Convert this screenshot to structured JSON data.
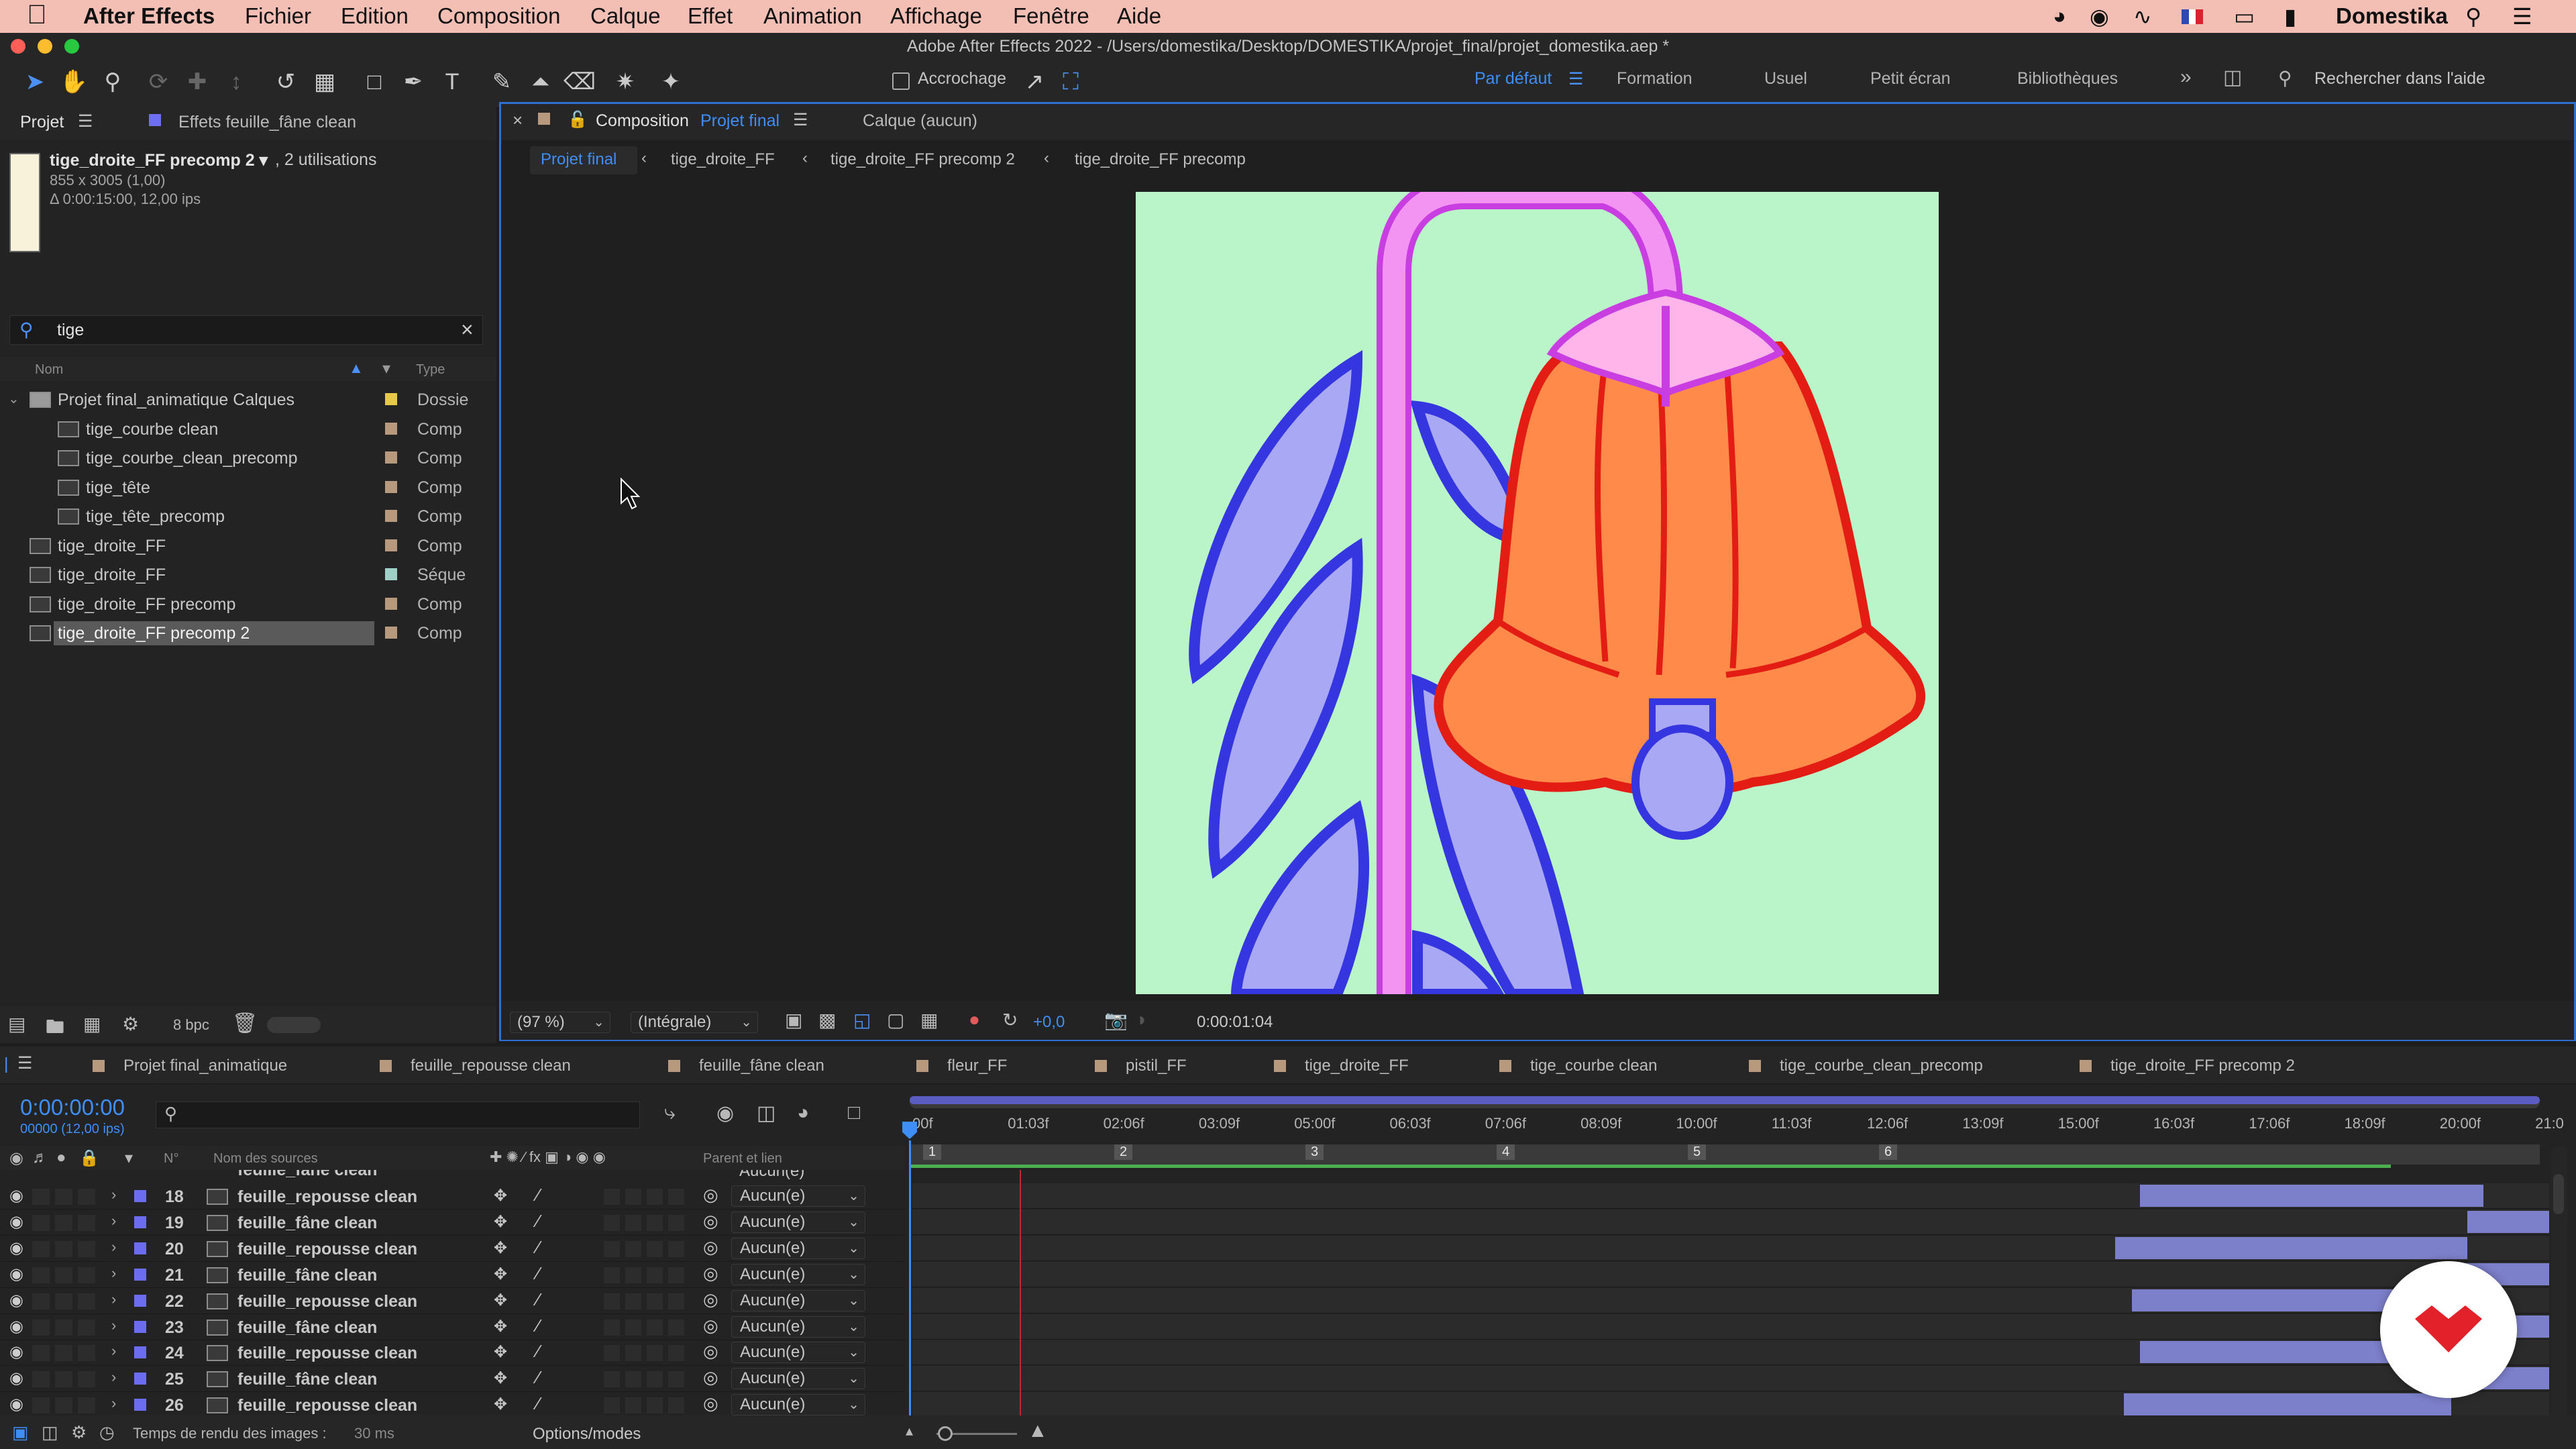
{
  "menubar": {
    "app": "After Effects",
    "items": [
      "Fichier",
      "Edition",
      "Composition",
      "Calque",
      "Effet",
      "Animation",
      "Affichage",
      "Fenêtre",
      "Aide"
    ],
    "right_label": "Domestika"
  },
  "window_title": "Adobe After Effects 2022 - /Users/domestika/Desktop/DOMESTIKA/projet_final/projet_domestika.aep *",
  "toolbar": {
    "snapping": "Accrochage",
    "workspaces": [
      "Par défaut",
      "Formation",
      "Usuel",
      "Petit écran",
      "Bibliothèques"
    ],
    "search_placeholder": "Rechercher dans l'aide"
  },
  "project_panel": {
    "tab_project": "Projet",
    "tab_effects": "Effets  feuille_fâne clean",
    "item_name": "tige_droite_FF precomp 2 ▾",
    "item_uses": ", 2 utilisations",
    "item_dims": "855 x 3005 (1,00)",
    "item_duration": "Δ 0:00:15:00, 12,00 ips",
    "search_value": "tige",
    "col_name": "Nom",
    "col_type": "Type",
    "bpc": "8 bpc",
    "rows": [
      {
        "name": "Projet final_animatique Calques",
        "type": "Dossie",
        "color": "#e6c94a",
        "level": 0
      },
      {
        "name": "tige_courbe clean",
        "type": "Comp",
        "color": "#b79a7e",
        "level": 1
      },
      {
        "name": "tige_courbe_clean_precomp",
        "type": "Comp",
        "color": "#b79a7e",
        "level": 1
      },
      {
        "name": "tige_tête",
        "type": "Comp",
        "color": "#b79a7e",
        "level": 1
      },
      {
        "name": "tige_tête_precomp",
        "type": "Comp",
        "color": "#b79a7e",
        "level": 1
      },
      {
        "name": "tige_droite_FF",
        "type": "Comp",
        "color": "#b79a7e",
        "level": 0
      },
      {
        "name": "tige_droite_FF",
        "type": "Séque",
        "color": "#9fd0c8",
        "level": 0
      },
      {
        "name": "tige_droite_FF precomp",
        "type": "Comp",
        "color": "#b79a7e",
        "level": 0
      },
      {
        "name": "tige_droite_FF precomp 2",
        "type": "Comp",
        "color": "#b79a7e",
        "level": 0,
        "selected": true
      }
    ]
  },
  "comp_panel": {
    "tab_label": "Composition",
    "tab_name": "Projet final",
    "layer_tab": "Calque  (aucun)",
    "breadcrumbs": [
      "Projet final",
      "tige_droite_FF",
      "tige_droite_FF precomp 2",
      "tige_droite_FF precomp"
    ],
    "zoom": "(97 %)",
    "resolution": "(Intégrale)",
    "exposure": "+0,0",
    "timecode": "0:00:01:04"
  },
  "timeline": {
    "tabs": [
      "Projet final_animatique",
      "feuille_repousse clean",
      "feuille_fâne clean",
      "fleur_FF",
      "pistil_FF",
      "tige_droite_FF",
      "tige_courbe clean",
      "tige_courbe_clean_precomp",
      "tige_droite_FF precomp 2"
    ],
    "current_time": "0:00:00:00",
    "frame_info": "00000 (12,00 ips)",
    "col_num": "N°",
    "col_source": "Nom des sources",
    "col_parent": "Parent et lien",
    "ruler_labels": [
      "00f",
      "01:03f",
      "02:06f",
      "03:09f",
      "05:00f",
      "06:03f",
      "07:06f",
      "08:09f",
      "10:00f",
      "11:03f",
      "12:06f",
      "13:09f",
      "15:00f",
      "16:03f",
      "17:06f",
      "18:09f",
      "20:00f",
      "21:0"
    ],
    "markers": [
      "1",
      "2",
      "3",
      "4",
      "5",
      "6"
    ],
    "partial_row_name": "feuille_fâne clean",
    "partial_row_parent": "Aucun(e)",
    "layers": [
      {
        "num": "18",
        "name": "feuille_repousse clean",
        "parent": "Aucun(e)",
        "bar_start": 0.75,
        "bar_end": 0.96
      },
      {
        "num": "19",
        "name": "feuille_fâne clean",
        "parent": "Aucun(e)",
        "bar_start": 0.95,
        "bar_end": 1.0
      },
      {
        "num": "20",
        "name": "feuille_repousse clean",
        "parent": "Aucun(e)",
        "bar_start": 0.735,
        "bar_end": 0.95
      },
      {
        "num": "21",
        "name": "feuille_fâne clean",
        "parent": "Aucun(e)",
        "bar_start": 0.94,
        "bar_end": 1.0
      },
      {
        "num": "22",
        "name": "feuille_repousse clean",
        "parent": "Aucun(e)",
        "bar_start": 0.745,
        "bar_end": 0.96
      },
      {
        "num": "23",
        "name": "feuille_fâne clean",
        "parent": "Aucun(e)",
        "bar_start": 0.955,
        "bar_end": 1.0
      },
      {
        "num": "24",
        "name": "feuille_repousse clean",
        "parent": "Aucun(e)",
        "bar_start": 0.75,
        "bar_end": 0.96
      },
      {
        "num": "25",
        "name": "feuille_fâne clean",
        "parent": "Aucun(e)",
        "bar_start": 0.955,
        "bar_end": 1.0
      },
      {
        "num": "26",
        "name": "feuille_repousse clean",
        "parent": "Aucun(e)",
        "bar_start": 0.74,
        "bar_end": 0.94
      }
    ],
    "render_time_label": "Temps de rendu des images :",
    "render_time_value": "30 ms",
    "options_label": "Options/modes"
  },
  "colors": {
    "accent": "#3f8ef5",
    "menubar_bg": "#f3bfb5",
    "canvas_bg": "#b9f5c8",
    "layer_bar": "#7c7fc9",
    "layer_label": "#6c6cf0",
    "domestika_red": "#e2212b"
  }
}
